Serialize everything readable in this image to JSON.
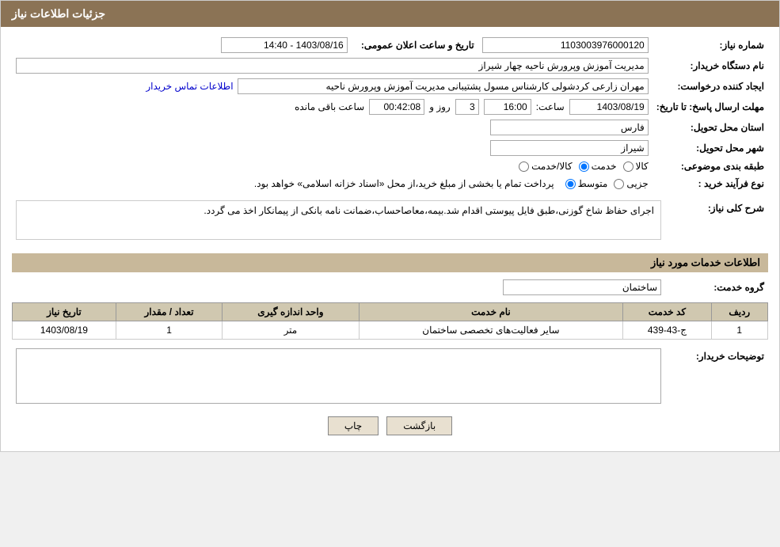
{
  "header": {
    "title": "جزئیات اطلاعات نیاز"
  },
  "fields": {
    "shomara_niaz_label": "شماره نیاز:",
    "shomara_niaz_value": "1103003976000120",
    "naam_dastgah_label": "نام دستگاه خریدار:",
    "naam_dastgah_value": "مدیریت آموزش وپرورش ناحیه چهار شیراز",
    "ijad_konande_label": "ایجاد کننده درخواست:",
    "ijad_konande_value": "مهران زارعی کردشولی کارشناس مسول پشتیبانی مدیریت آموزش وپرورش ناحیه",
    "contact_info_link": "اطلاعات تماس خریدار",
    "mohlat_label": "مهلت ارسال پاسخ: تا تاریخ:",
    "mohlat_date": "1403/08/19",
    "mohlat_time_label": "ساعت:",
    "mohlat_time": "16:00",
    "mohlat_days_label": "روز و",
    "mohlat_days": "3",
    "mohlat_remaining_label": "ساعت باقی مانده",
    "mohlat_remaining": "00:42:08",
    "tarikh_label": "تاریخ و ساعت اعلان عمومی:",
    "tarikh_value": "1403/08/16 - 14:40",
    "ostan_label": "استان محل تحویل:",
    "ostan_value": "فارس",
    "shahr_label": "شهر محل تحویل:",
    "shahr_value": "شیراز",
    "tabaqe_label": "طبقه بندی موضوعی:",
    "radio_kala": "کالا",
    "radio_khadamat": "خدمت",
    "radio_kala_khadamat": "کالا/خدمت",
    "radio_selected": "khadamat",
    "navae_farayand_label": "نوع فرآیند خرید :",
    "radio_jozi": "جزیی",
    "radio_motevasset": "متوسط",
    "notice_text": "پرداخت تمام یا بخشی از مبلغ خرید،از محل «اسناد خزانه اسلامی» خواهد بود.",
    "sharh_label": "شرح کلی نیاز:",
    "sharh_text": "اجرای حفاظ شاخ گوزنی،طبق فایل پیوستی اقدام شد.بیمه،معاصاحساب،ضمانت نامه بانکی از پیمانکار اخذ می گردد.",
    "khidamat_section_title": "اطلاعات خدمات مورد نیاز",
    "gorooh_khadamat_label": "گروه خدمت:",
    "gorooh_khadamat_value": "ساختمان",
    "table_headers": {
      "radif": "ردیف",
      "code_khadamat": "کد خدمت",
      "naam_khadamat": "نام خدمت",
      "vahed": "واحد اندازه گیری",
      "tedad": "تعداد / مقدار",
      "tarikh_niaz": "تاریخ نیاز"
    },
    "table_rows": [
      {
        "radif": "1",
        "code_khadamat": "ج-43-439",
        "naam_khadamat": "سایر فعالیت‌های تخصصی ساختمان",
        "vahed": "متر",
        "tedad": "1",
        "tarikh_niaz": "1403/08/19"
      }
    ],
    "description_label": "توضیحات خریدار:",
    "description_value": "",
    "btn_back": "بازگشت",
    "btn_print": "چاپ"
  }
}
